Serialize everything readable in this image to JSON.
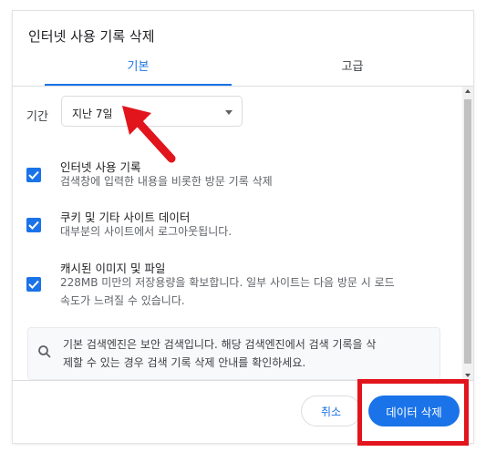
{
  "dialog": {
    "title": "인터넷 사용 기록 삭제",
    "tabs": [
      {
        "label": "기본",
        "active": true
      },
      {
        "label": "고급",
        "active": false
      }
    ]
  },
  "period": {
    "label": "기간",
    "selected": "지난 7일"
  },
  "options": [
    {
      "title": "인터넷 사용 기록",
      "desc": [
        "검색창에 입력한 내용을 비롯한 방문 기록 삭제"
      ],
      "checked": true
    },
    {
      "title": "쿠키 및 기타 사이트 데이터",
      "desc": [
        "대부분의 사이트에서 로그아웃됩니다."
      ],
      "checked": true
    },
    {
      "title": "캐시된 이미지 및 파일",
      "desc": [
        "228MB 미만의 저장용량을 확보합니다. 일부 사이트는 다음 방문 시 로드",
        "속도가 느려질 수 있습니다."
      ],
      "checked": true
    }
  ],
  "info": {
    "icon": "search-icon",
    "text": [
      "기본 검색엔진은 보안 검색입니다. 해당 검색엔진에서 검색 기록을 삭",
      "제할 수 있는 경우 검색 기록 삭제 안내를 확인하세요."
    ]
  },
  "footer": {
    "cancel_label": "취소",
    "delete_label": "데이터 삭제"
  },
  "colors": {
    "accent": "#1a73e8",
    "annotation": "#e2141c"
  }
}
